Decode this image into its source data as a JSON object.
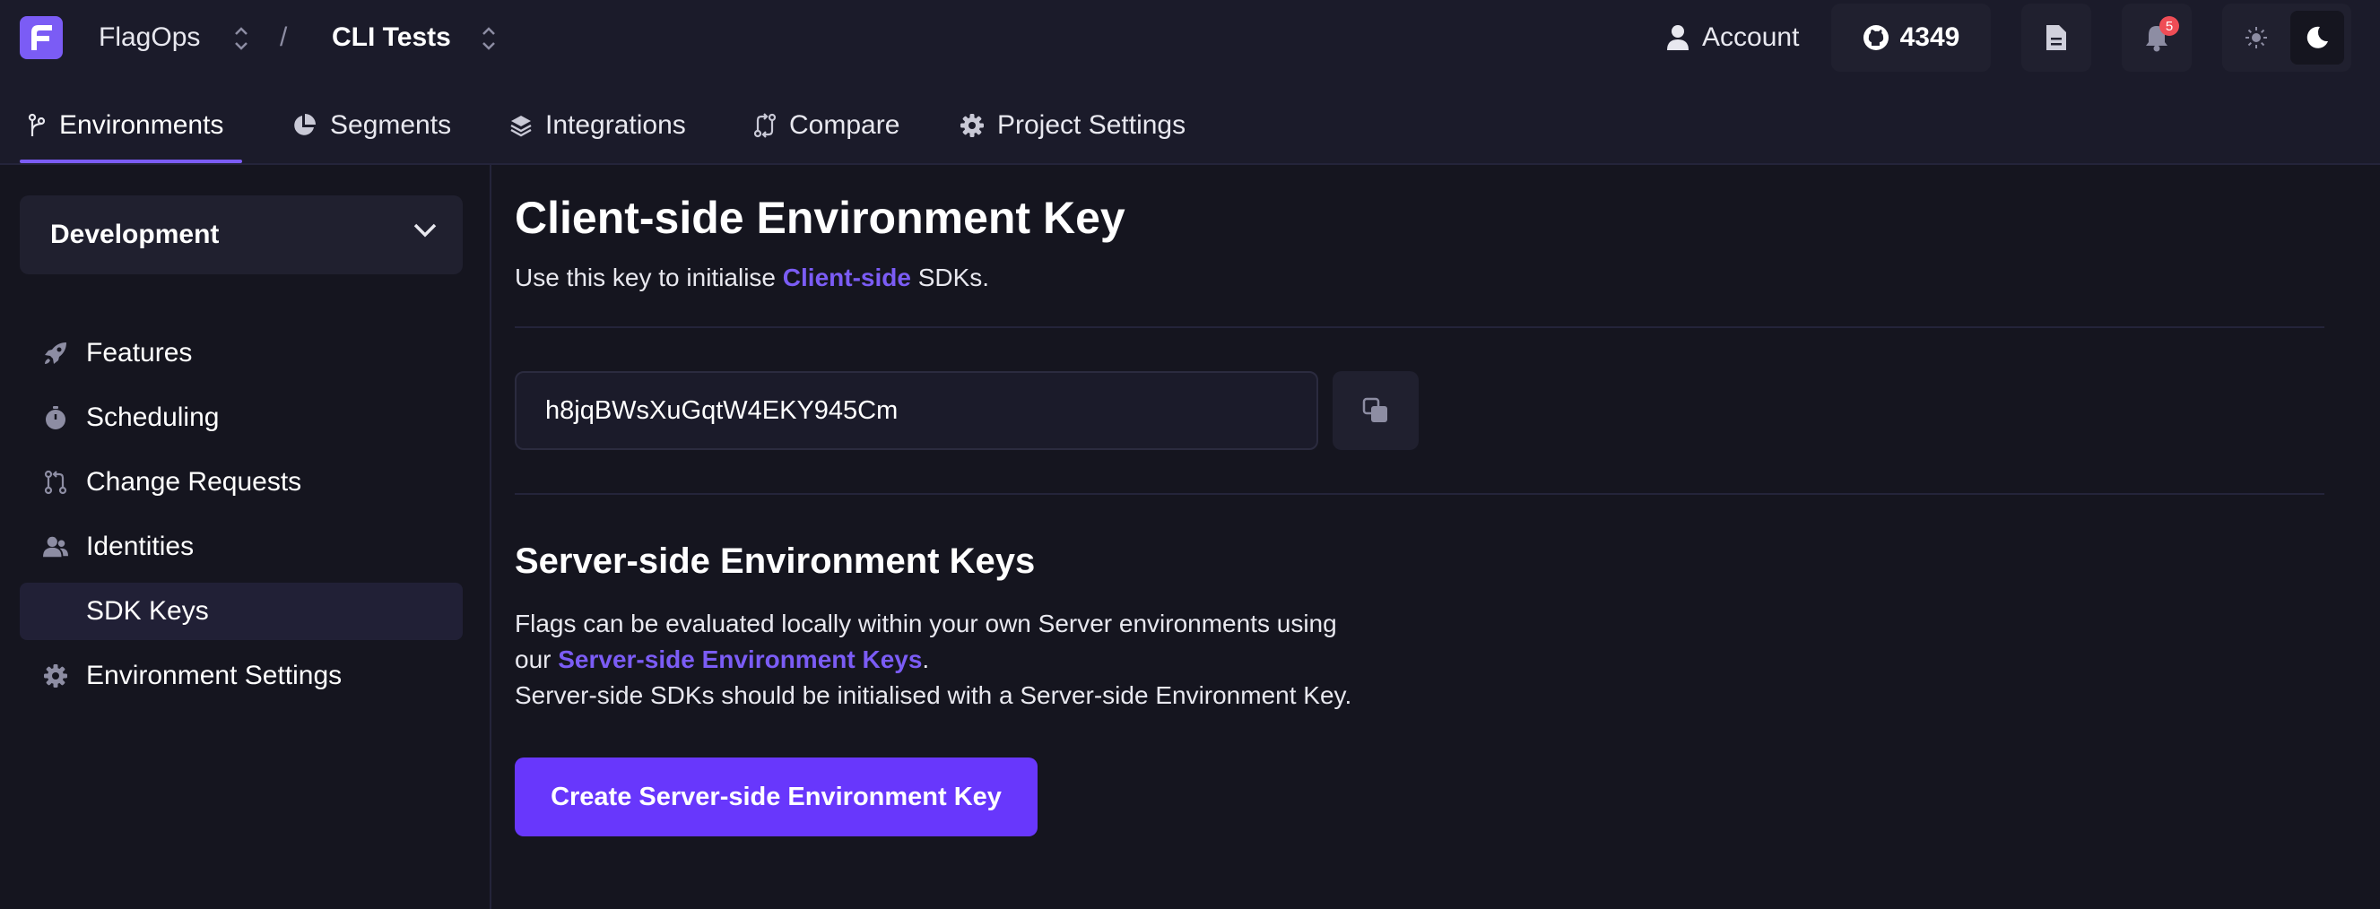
{
  "header": {
    "org_name": "FlagOps",
    "separator": "/",
    "project_name": "CLI Tests",
    "account_label": "Account",
    "github_stars": "4349",
    "notifications_count": "5"
  },
  "tabs": [
    {
      "label": "Environments",
      "icon": "branch-icon",
      "active": true
    },
    {
      "label": "Segments",
      "icon": "pie-chart-icon"
    },
    {
      "label": "Integrations",
      "icon": "layers-icon"
    },
    {
      "label": "Compare",
      "icon": "compare-icon"
    },
    {
      "label": "Project Settings",
      "icon": "gear-icon"
    }
  ],
  "sidebar": {
    "environment": "Development",
    "items": [
      {
        "label": "Features",
        "icon": "rocket-icon"
      },
      {
        "label": "Scheduling",
        "icon": "timer-icon"
      },
      {
        "label": "Change Requests",
        "icon": "pull-request-icon"
      },
      {
        "label": "Identities",
        "icon": "users-icon"
      },
      {
        "label": "SDK Keys",
        "icon": "",
        "active": true
      },
      {
        "label": "Environment Settings",
        "icon": "gear-icon"
      }
    ]
  },
  "main": {
    "client_title": "Client-side Environment Key",
    "client_desc_prefix": "Use this key to initialise ",
    "client_desc_link": "Client-side",
    "client_desc_suffix": " SDKs.",
    "client_key": "h8jqBWsXuGqtW4EKY945Cm",
    "server_title": "Server-side Environment Keys",
    "server_desc_line1": "Flags can be evaluated locally within your own Server environments using",
    "server_desc_line2_prefix": "our ",
    "server_desc_line2_link": "Server-side Environment Keys",
    "server_desc_line2_suffix": ".",
    "server_desc_line3": "Server-side SDKs should be initialised with a Server-side Environment Key.",
    "create_button": "Create Server-side Environment Key"
  },
  "colors": {
    "accent": "#7b5cf5",
    "primary_button": "#6837fc",
    "background": "#15151f",
    "header": "#1b1b2a",
    "badge": "#ef4d56"
  }
}
